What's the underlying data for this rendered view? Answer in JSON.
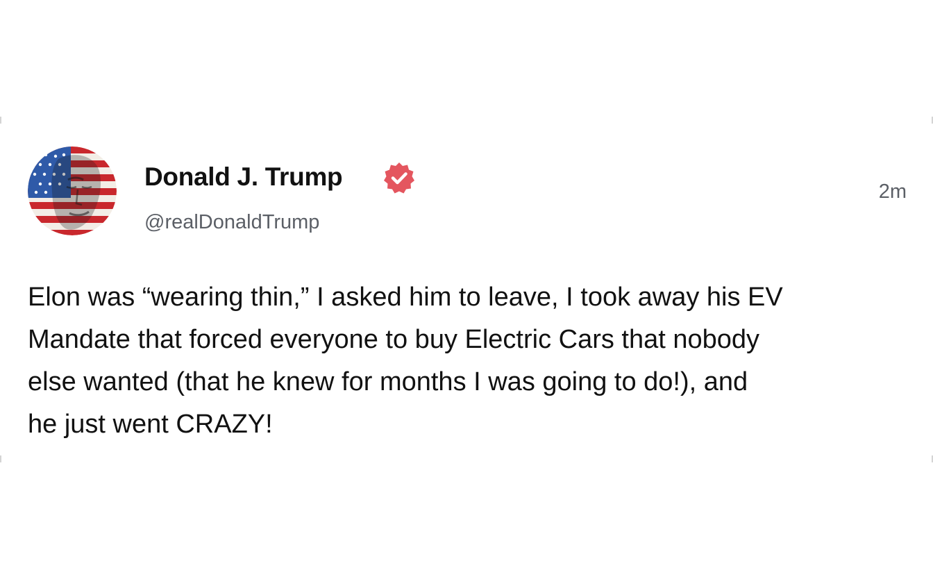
{
  "post": {
    "author": {
      "display_name": "Donald J. Trump",
      "handle": "@realDonaldTrump",
      "verified": true,
      "avatar_icon": "flag-portrait-avatar"
    },
    "timestamp": "2m",
    "text": "Elon was “wearing thin,” I asked him to leave, I took away his EV\nMandate that forced everyone to buy Electric Cars that nobody\nelse wanted (that he knew for months I was going to do!), and\nhe just went CRAZY!"
  },
  "colors": {
    "background": "#ffffff",
    "text": "#111111",
    "muted": "#5b5f66",
    "verified_badge": "#e4565f",
    "flag_red": "#c9282d",
    "flag_blue": "#2f5aa8"
  }
}
